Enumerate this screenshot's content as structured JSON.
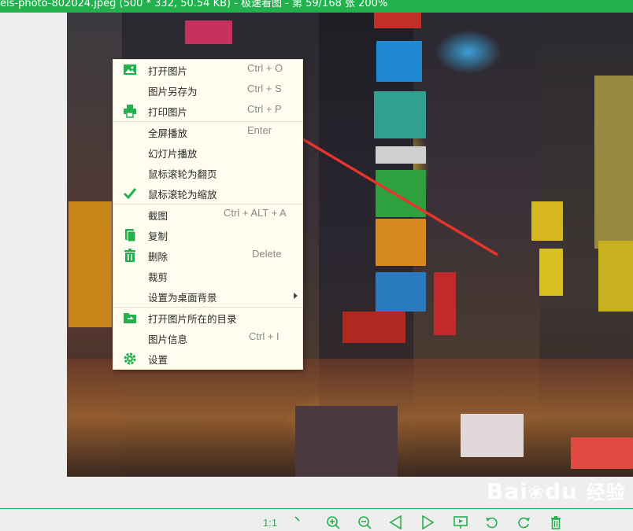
{
  "title_bar": {
    "text": "els-photo-802024.jpeg (500 * 332, 50.54 KB) - 极速看图 - 第 59/168 张 200%"
  },
  "context_menu": {
    "items": [
      {
        "label": "打开图片",
        "shortcut": "Ctrl + O",
        "icon": "image-icon"
      },
      {
        "label": "图片另存为",
        "shortcut": "Ctrl + S",
        "icon": ""
      },
      {
        "label": "打印图片",
        "shortcut": "Ctrl + P",
        "icon": "printer-icon"
      },
      {
        "label": "全屏播放",
        "shortcut": "Enter",
        "icon": ""
      },
      {
        "label": "幻灯片播放",
        "shortcut": "",
        "icon": ""
      },
      {
        "label": "鼠标滚轮为翻页",
        "shortcut": "",
        "icon": ""
      },
      {
        "label": "鼠标滚轮为缩放",
        "shortcut": "",
        "icon": "checkmark-icon"
      },
      {
        "label": "截图",
        "shortcut": "Ctrl + ALT + A",
        "icon": ""
      },
      {
        "label": "复制",
        "shortcut": "",
        "icon": "copy-icon"
      },
      {
        "label": "删除",
        "shortcut": "Delete",
        "icon": "trash-icon"
      },
      {
        "label": "裁剪",
        "shortcut": "",
        "icon": ""
      },
      {
        "label": "设置为桌面背景",
        "shortcut": "",
        "icon": ""
      },
      {
        "label": "打开图片所在的目录",
        "shortcut": "",
        "icon": "folder-open-icon"
      },
      {
        "label": "图片信息",
        "shortcut": "Ctrl + I",
        "icon": ""
      },
      {
        "label": "设置",
        "shortcut": "",
        "icon": "gear-icon"
      }
    ]
  },
  "toolbar": {
    "actual_size_label": "1:1",
    "buttons": [
      "fit-window-icon",
      "zoom-in-icon",
      "zoom-out-icon",
      "previous-icon",
      "next-icon",
      "slideshow-icon",
      "rotate-left-icon",
      "rotate-right-icon",
      "delete-icon"
    ]
  },
  "watermark": {
    "brand": "Bai",
    "brand2": "du",
    "suffix": "经验"
  },
  "colors": {
    "accent": "#23b14d",
    "menu_bg": "#fffdf0",
    "arrow": "#e8352b"
  }
}
